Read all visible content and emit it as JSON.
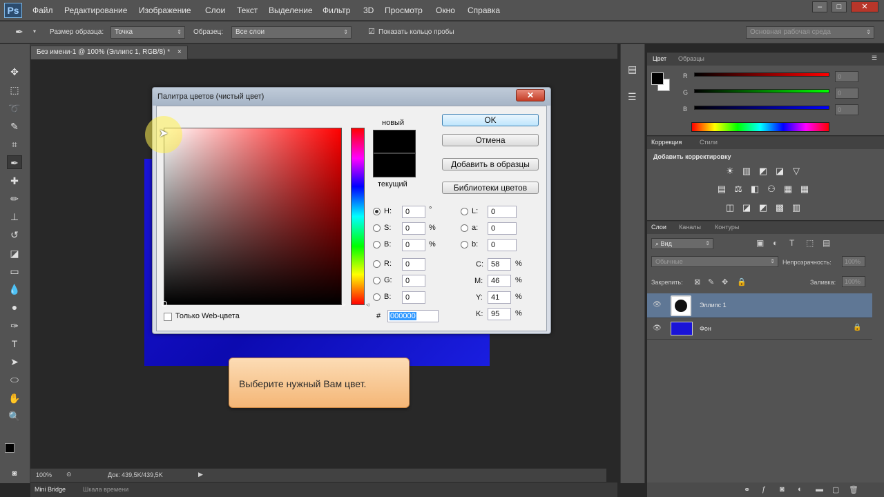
{
  "app": {
    "logo": "Ps",
    "menu": [
      "Файл",
      "Редактирование",
      "Изображение",
      "Слои",
      "Текст",
      "Выделение",
      "Фильтр",
      "3D",
      "Просмотр",
      "Окно",
      "Справка"
    ],
    "window_controls": [
      "–",
      "□",
      "✕"
    ]
  },
  "options_bar": {
    "sample_size_label": "Размер образца:",
    "sample_size_value": "Точка",
    "sample_label": "Образец:",
    "sample_value": "Все слои",
    "show_ring_label": "Показать кольцо пробы",
    "workspace": "Основная рабочая среда"
  },
  "document": {
    "tab_title": "Без имени-1 @ 100% (Эллипс 1, RGB/8) *",
    "tab_close": "×",
    "zoom": "100%",
    "doc_info": "Док: 439,5K/439,5K"
  },
  "bottom_tabs": [
    "Mini Bridge",
    "Шкала времени"
  ],
  "color_panel": {
    "tabs": [
      "Цвет",
      "Образцы"
    ],
    "channels": [
      {
        "label": "R",
        "value": "0",
        "color": "#d02020"
      },
      {
        "label": "G",
        "value": "0",
        "color": "#20a020"
      },
      {
        "label": "B",
        "value": "0",
        "color": "#2020d0"
      }
    ]
  },
  "adjustments_panel": {
    "tabs": [
      "Коррекция",
      "Стили"
    ],
    "title": "Добавить корректировку",
    "rows": [
      [
        "☀",
        "▥",
        "◩",
        "◪",
        "▽"
      ],
      [
        "▤",
        "⚖",
        "◧",
        "⚇",
        "▦"
      ],
      [
        "◫",
        "◪",
        "◩",
        "▩",
        "▥"
      ]
    ]
  },
  "layers_panel": {
    "tabs": [
      "Слои",
      "Каналы",
      "Контуры"
    ],
    "filter_value": "Вид",
    "blend_mode": "Обычные",
    "opacity_label": "Непрозрачность:",
    "opacity_value": "100%",
    "lock_label": "Закрепить:",
    "fill_label": "Заливка:",
    "fill_value": "100%",
    "layers": [
      {
        "name": "Эллипс 1",
        "selected": true
      },
      {
        "name": "Фон",
        "selected": false
      }
    ]
  },
  "color_picker": {
    "title": "Палитра цветов (чистый цвет)",
    "close": "✕",
    "new_label": "новый",
    "current_label": "текущий",
    "buttons": {
      "ok": "OK",
      "cancel": "Отмена",
      "add_to_swatches": "Добавить в образцы",
      "color_libraries": "Библиотеки цветов"
    },
    "hsb": [
      {
        "label": "H:",
        "value": "0",
        "unit": "°",
        "selected": true
      },
      {
        "label": "S:",
        "value": "0",
        "unit": "%",
        "selected": false
      },
      {
        "label": "B:",
        "value": "0",
        "unit": "%",
        "selected": false
      }
    ],
    "rgb": [
      {
        "label": "R:",
        "value": "0"
      },
      {
        "label": "G:",
        "value": "0"
      },
      {
        "label": "B:",
        "value": "0"
      }
    ],
    "lab": [
      {
        "label": "L:",
        "value": "0"
      },
      {
        "label": "a:",
        "value": "0"
      },
      {
        "label": "b:",
        "value": "0"
      }
    ],
    "cmyk": [
      {
        "label": "C:",
        "value": "58",
        "unit": "%"
      },
      {
        "label": "M:",
        "value": "46",
        "unit": "%"
      },
      {
        "label": "Y:",
        "value": "41",
        "unit": "%"
      },
      {
        "label": "K:",
        "value": "95",
        "unit": "%"
      }
    ],
    "hex_label": "#",
    "hex_value": "000000",
    "web_only_label": "Только Web-цвета"
  },
  "tooltip": {
    "text": "Выберите нужный Вам цвет."
  }
}
